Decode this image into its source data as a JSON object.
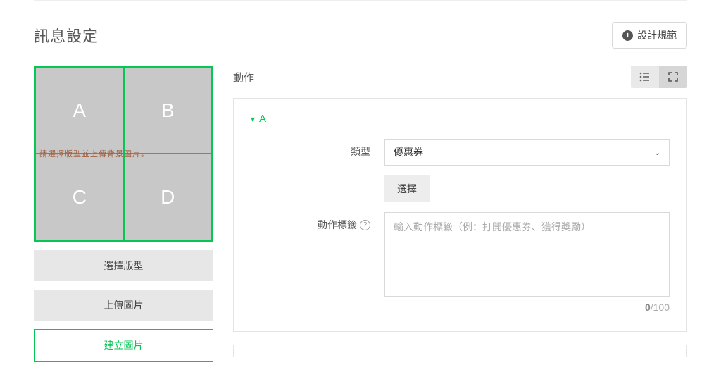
{
  "section_title": "訊息設定",
  "design_spec_btn": "設計規範",
  "grid": {
    "cells": [
      "A",
      "B",
      "C",
      "D"
    ],
    "overlay": "請選擇版型並上傳背景圖片。"
  },
  "left_buttons": {
    "select_template": "選擇版型",
    "upload_image": "上傳圖片",
    "create_image": "建立圖片"
  },
  "actions": {
    "label": "動作",
    "panels": [
      {
        "name": "A",
        "fields": {
          "type_label": "類型",
          "type_value": "優惠券",
          "choose_btn": "選擇",
          "tag_label": "動作標籤",
          "tag_placeholder": "輸入動作標籤（例：打開優惠券、獲得獎勵）",
          "counter_current": "0",
          "counter_max": "/100"
        }
      }
    ]
  }
}
